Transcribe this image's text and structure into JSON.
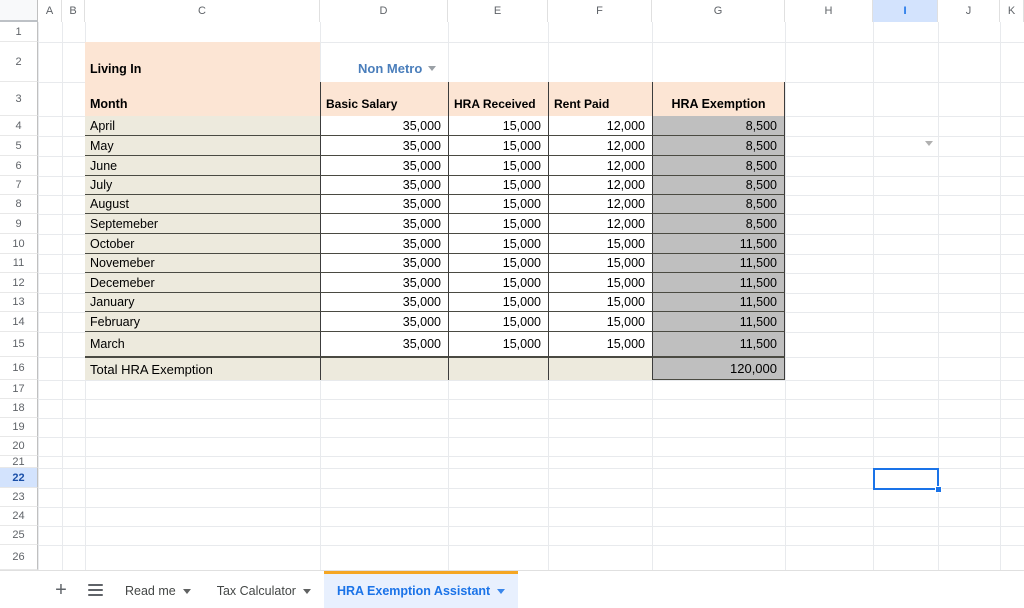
{
  "spreadsheet": {
    "column_headers": [
      "A",
      "B",
      "C",
      "D",
      "E",
      "F",
      "G",
      "H",
      "I",
      "J",
      "K"
    ],
    "selected_column": "I",
    "selected_cell": "I22",
    "selected_row": "22",
    "row_numbers": [
      "1",
      "2",
      "3",
      "4",
      "5",
      "6",
      "7",
      "8",
      "9",
      "10",
      "11",
      "12",
      "13",
      "14",
      "15",
      "16",
      "17",
      "18",
      "19",
      "20",
      "21",
      "22",
      "23",
      "24",
      "25",
      "26"
    ]
  },
  "sheet": {
    "living_in_label": "Living In",
    "living_in_value": "Non Metro",
    "headers": {
      "month": "Month",
      "basic_salary": "Basic Salary",
      "hra_received": "HRA Received",
      "rent_paid": "Rent Paid",
      "hra_exemption": "HRA Exemption"
    },
    "rows": [
      {
        "month": "April",
        "basic_salary": "35,000",
        "hra_received": "15,000",
        "rent_paid": "12,000",
        "hra_exemption": "8,500"
      },
      {
        "month": "May",
        "basic_salary": "35,000",
        "hra_received": "15,000",
        "rent_paid": "12,000",
        "hra_exemption": "8,500"
      },
      {
        "month": "June",
        "basic_salary": "35,000",
        "hra_received": "15,000",
        "rent_paid": "12,000",
        "hra_exemption": "8,500"
      },
      {
        "month": "July",
        "basic_salary": "35,000",
        "hra_received": "15,000",
        "rent_paid": "12,000",
        "hra_exemption": "8,500"
      },
      {
        "month": "August",
        "basic_salary": "35,000",
        "hra_received": "15,000",
        "rent_paid": "12,000",
        "hra_exemption": "8,500"
      },
      {
        "month": "Septemeber",
        "basic_salary": "35,000",
        "hra_received": "15,000",
        "rent_paid": "12,000",
        "hra_exemption": "8,500"
      },
      {
        "month": "October",
        "basic_salary": "35,000",
        "hra_received": "15,000",
        "rent_paid": "15,000",
        "hra_exemption": "11,500"
      },
      {
        "month": "Novemeber",
        "basic_salary": "35,000",
        "hra_received": "15,000",
        "rent_paid": "15,000",
        "hra_exemption": "11,500"
      },
      {
        "month": "Decemeber",
        "basic_salary": "35,000",
        "hra_received": "15,000",
        "rent_paid": "15,000",
        "hra_exemption": "11,500"
      },
      {
        "month": "January",
        "basic_salary": "35,000",
        "hra_received": "15,000",
        "rent_paid": "15,000",
        "hra_exemption": "11,500"
      },
      {
        "month": "February",
        "basic_salary": "35,000",
        "hra_received": "15,000",
        "rent_paid": "15,000",
        "hra_exemption": "11,500"
      },
      {
        "month": "March",
        "basic_salary": "35,000",
        "hra_received": "15,000",
        "rent_paid": "15,000",
        "hra_exemption": "11,500"
      }
    ],
    "total": {
      "label": "Total HRA Exemption",
      "value": "120,000"
    }
  },
  "sheet_bar": {
    "add_sheet_icon": "plus-icon",
    "all_sheets_icon": "hamburger-icon",
    "tabs": [
      {
        "label": "Read me",
        "active": false
      },
      {
        "label": "Tax Calculator",
        "active": false
      },
      {
        "label": "HRA Exemption Assistant",
        "active": true
      }
    ]
  },
  "colors": {
    "header_peach": "#fce5d4",
    "row_beige": "#edeadd",
    "exemption_gray": "#bfbfbf",
    "accent_blue": "#1a73e8",
    "link_blue": "#4a7ebb",
    "active_tab_underline": "#f5a623"
  }
}
